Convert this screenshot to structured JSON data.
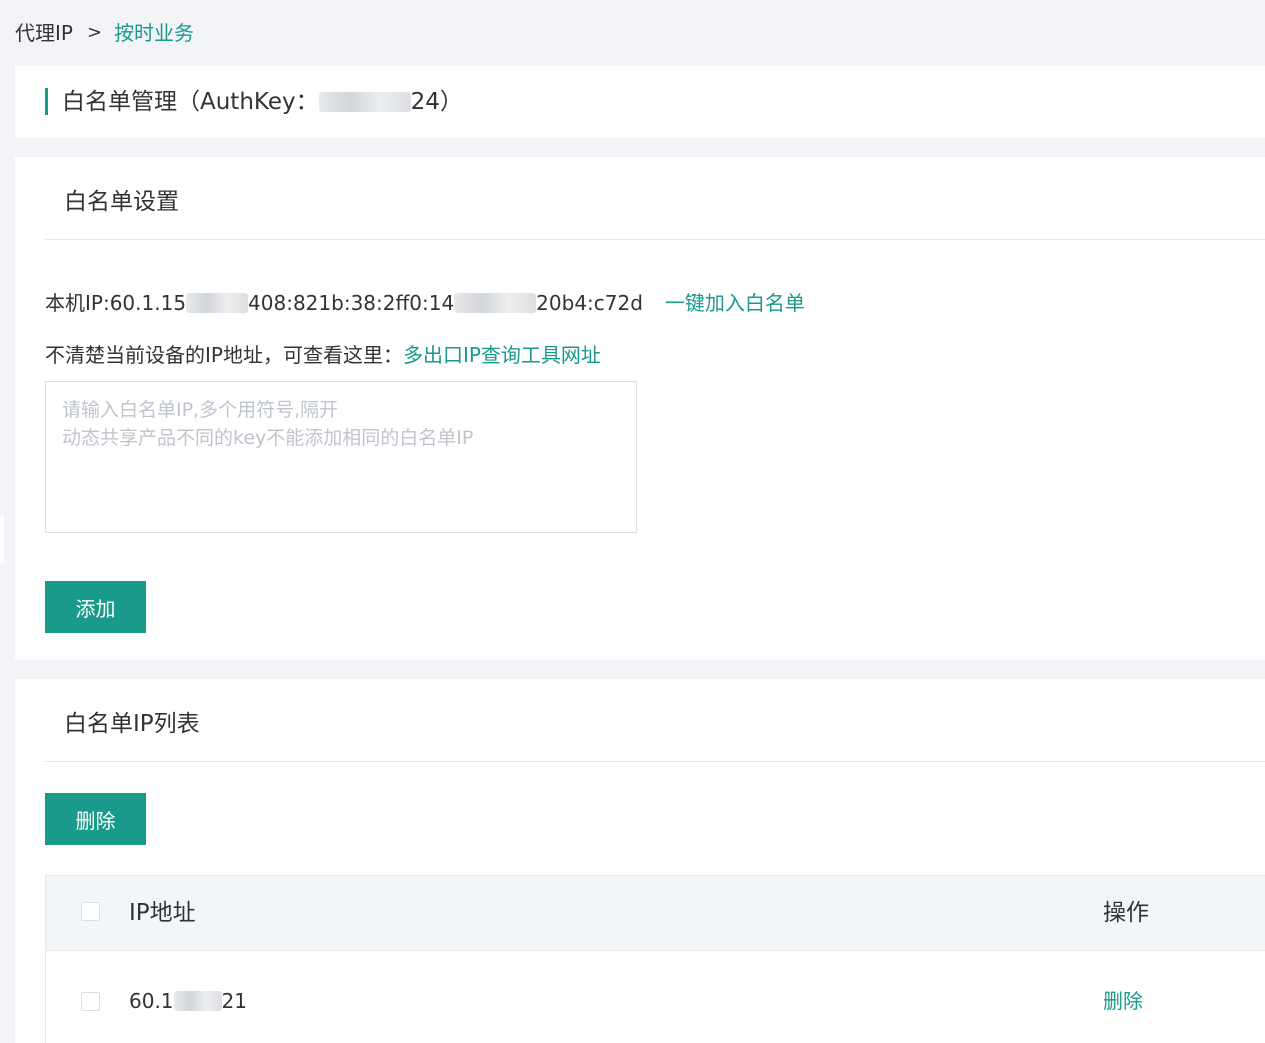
{
  "breadcrumb": {
    "root": "代理IP",
    "separator": ">",
    "current": "按时业务"
  },
  "header": {
    "title_prefix": "白名单管理（AuthKey：",
    "authkey_visible_start": "",
    "authkey_visible_end": "24",
    "title_suffix": "）"
  },
  "settings": {
    "section_title": "白名单设置",
    "local_ip_label": "本机IP: ",
    "local_ip_part1": "60.1.15",
    "local_ip_part2": "408:821b:38:2ff0:14",
    "local_ip_part3": "20b4:c72d",
    "one_click_add_link": "一键加入白名单",
    "hint_text": "不清楚当前设备的IP地址，可查看这里：",
    "hint_link": "多出口IP查询工具网址",
    "textarea_placeholder": "请输入白名单IP,多个用符号,隔开\n动态共享产品不同的key不能添加相同的白名单IP",
    "add_button": "添加"
  },
  "list": {
    "section_title": "白名单IP列表",
    "delete_button": "删除",
    "columns": {
      "ip": "IP地址",
      "action": "操作"
    },
    "rows": [
      {
        "ip_start": "60.1",
        "ip_end": "21",
        "action": "删除"
      }
    ]
  },
  "colors": {
    "accent": "#1a9a8a",
    "page_bg": "#f2f4f7",
    "table_header_bg": "#f3f6f9"
  }
}
